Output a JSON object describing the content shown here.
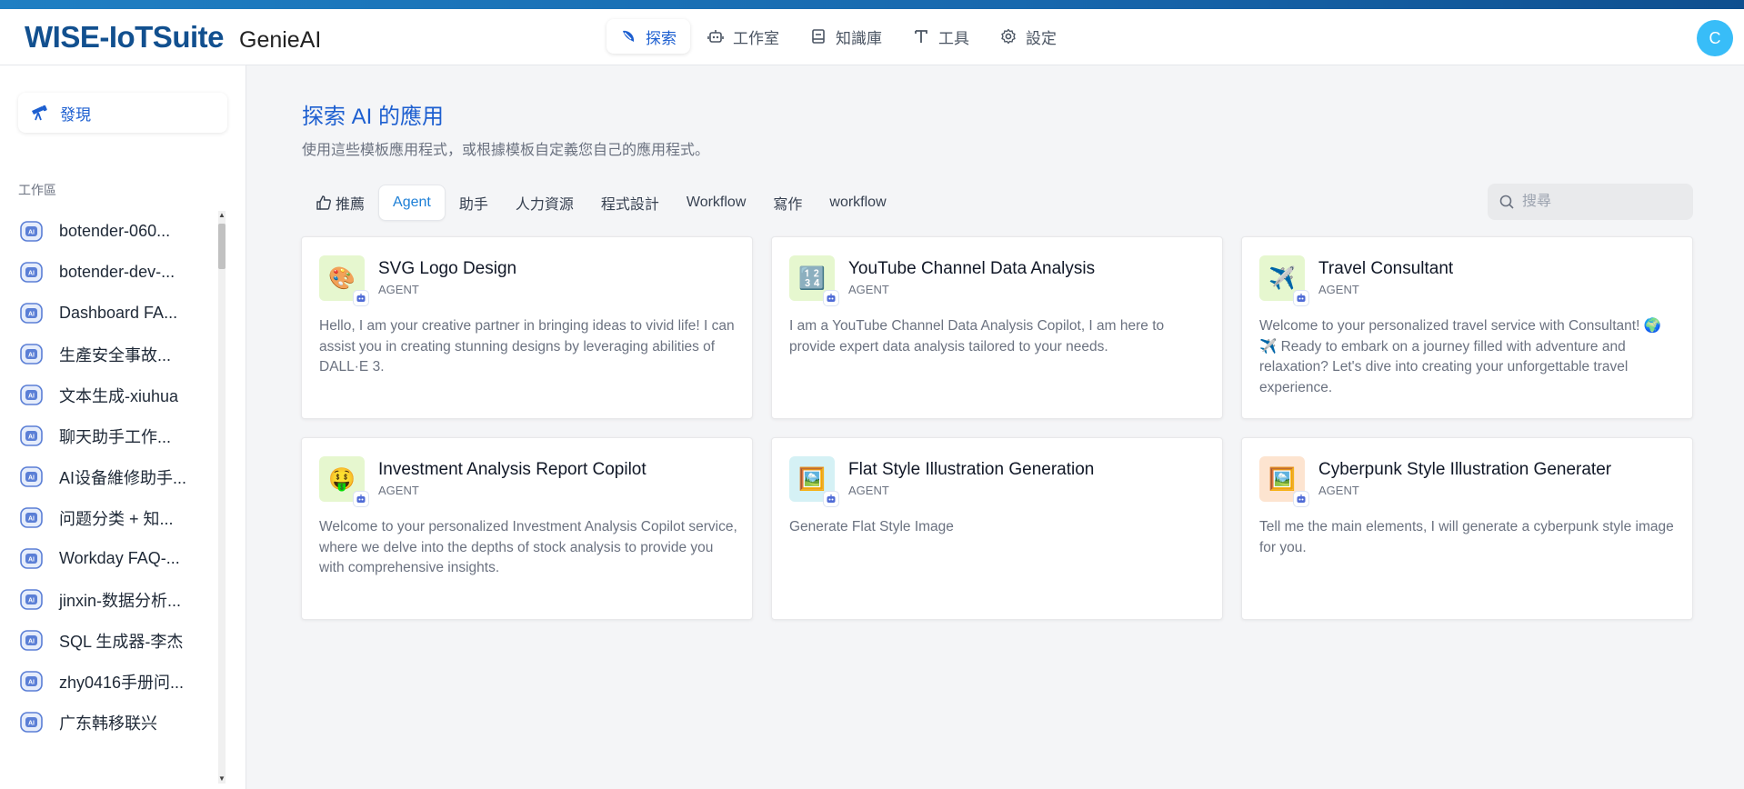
{
  "header": {
    "brand": "WISE-IoTSuite",
    "product": "GenieAI",
    "nav": [
      {
        "label": "探索",
        "icon": "compass-icon",
        "active": true
      },
      {
        "label": "工作室",
        "icon": "robot-icon",
        "active": false
      },
      {
        "label": "知識庫",
        "icon": "book-icon",
        "active": false
      },
      {
        "label": "工具",
        "icon": "tool-icon",
        "active": false
      },
      {
        "label": "設定",
        "icon": "gear-icon",
        "active": false
      }
    ],
    "avatar_initial": "C"
  },
  "sidebar": {
    "discover_label": "發現",
    "workspace_label": "工作區",
    "items": [
      {
        "label": "botender-060..."
      },
      {
        "label": "botender-dev-..."
      },
      {
        "label": "Dashboard FA..."
      },
      {
        "label": "生產安全事故..."
      },
      {
        "label": "文本生成-xiuhua"
      },
      {
        "label": "聊天助手工作..."
      },
      {
        "label": "AI设备維修助手..."
      },
      {
        "label": "问题分类 + 知..."
      },
      {
        "label": "Workday FAQ-..."
      },
      {
        "label": "jinxin-数据分析..."
      },
      {
        "label": "SQL 生成器-李杰"
      },
      {
        "label": "zhy0416手册问..."
      },
      {
        "label": "广东韩移联兴"
      }
    ]
  },
  "main": {
    "title": "探索 AI 的應用",
    "subtitle": "使用這些模板應用程式，或根據模板自定義您自己的應用程式。",
    "tabs": [
      {
        "label": "推薦",
        "active": false,
        "icon": "thumbs-up-icon"
      },
      {
        "label": "Agent",
        "active": true
      },
      {
        "label": "助手",
        "active": false
      },
      {
        "label": "人力資源",
        "active": false
      },
      {
        "label": "程式設計",
        "active": false
      },
      {
        "label": "Workflow",
        "active": false
      },
      {
        "label": "寫作",
        "active": false
      },
      {
        "label": "workflow",
        "active": false
      }
    ],
    "search_placeholder": "搜尋",
    "cards": [
      {
        "name": "SVG Logo Design",
        "type": "AGENT",
        "emoji": "🎨",
        "bg": "#e6f7cf",
        "desc": "Hello, I am your creative partner in bringing ideas to vivid life! I can assist you in creating stunning designs by leveraging abilities of DALL·E 3."
      },
      {
        "name": "YouTube Channel Data Analysis",
        "type": "AGENT",
        "emoji": "🔢",
        "bg": "#e6f7cf",
        "desc": "I am a YouTube Channel Data Analysis Copilot, I am here to provide expert data analysis tailored to your needs."
      },
      {
        "name": "Travel Consultant",
        "type": "AGENT",
        "emoji": "✈️",
        "bg": "#e6f7cf",
        "desc": "Welcome to your personalized travel service with Consultant! 🌍✈️ Ready to embark on a journey filled with adventure and relaxation? Let's dive into creating your unforgettable travel experience."
      },
      {
        "name": "Investment Analysis Report Copilot",
        "type": "AGENT",
        "emoji": "🤑",
        "bg": "#e6f7cf",
        "desc": "Welcome to your personalized Investment Analysis Copilot service, where we delve into the depths of stock analysis to provide you with comprehensive insights."
      },
      {
        "name": "Flat Style Illustration Generation",
        "type": "AGENT",
        "emoji": "🖼️",
        "bg": "#d5f1f5",
        "desc": "Generate Flat Style Image"
      },
      {
        "name": "Cyberpunk Style Illustration Generater",
        "type": "AGENT",
        "emoji": "🖼️",
        "bg": "#fde4d0",
        "desc": "Tell me the main elements, I will generate a cyberpunk style image for you."
      }
    ]
  }
}
